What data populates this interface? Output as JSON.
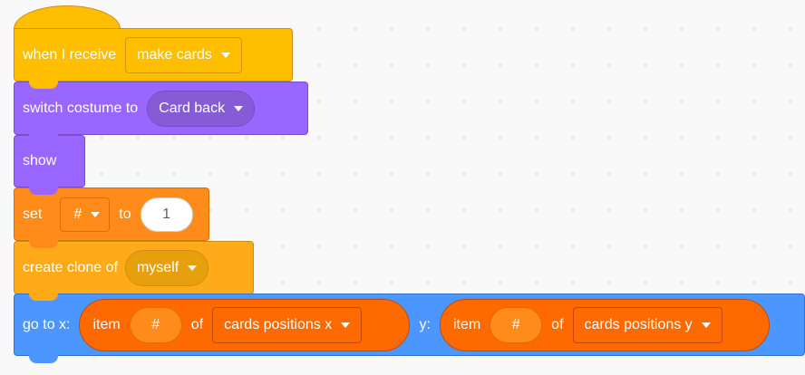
{
  "blocks": {
    "when_receive": {
      "label": "when I receive",
      "message": "make cards"
    },
    "switch_costume": {
      "label": "switch costume to",
      "costume": "Card back"
    },
    "show": {
      "label": "show"
    },
    "set_var": {
      "label": "set",
      "variable": "#",
      "to_label": "to",
      "value": "1"
    },
    "create_clone": {
      "label": "create clone of",
      "target": "myself"
    },
    "go_to_xy": {
      "label": "go to x:",
      "x_item": {
        "label": "item",
        "index": "#",
        "of": "of",
        "list": "cards positions x"
      },
      "y_label": "y:",
      "y_item": {
        "label": "item",
        "index": "#",
        "of": "of",
        "list": "cards positions y"
      }
    }
  },
  "colors": {
    "events": "#ffbf00",
    "looks": "#9966ff",
    "variables": "#ff8c1a",
    "control": "#ffab19",
    "motion": "#4c97ff",
    "lists": "#ff6a00"
  },
  "icons": [
    "dropdown-caret-icon"
  ]
}
